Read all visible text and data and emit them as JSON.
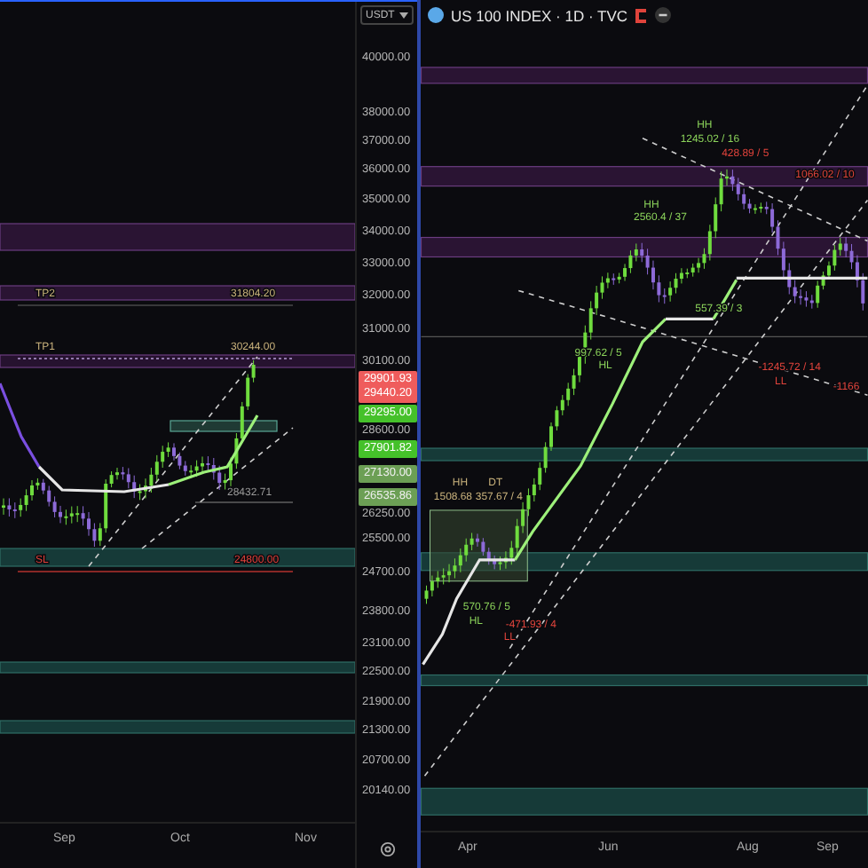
{
  "left_chart": {
    "currency_select": "USDT",
    "price_axis": [
      "40000.00",
      "38000.00",
      "37000.00",
      "36000.00",
      "35000.00",
      "34000.00",
      "33000.00",
      "32000.00",
      "31000.00",
      "30100.00",
      "28600.00",
      "26250.00",
      "25500.00",
      "24700.00",
      "23800.00",
      "23100.00",
      "22500.00",
      "21900.00",
      "21300.00",
      "20700.00",
      "20140.00"
    ],
    "price_tags": [
      {
        "lines": [
          "29901.93",
          "29440.20"
        ],
        "kind": "last"
      },
      {
        "lines": [
          "29295.00"
        ],
        "kind": "position"
      },
      {
        "lines": [
          "27901.82"
        ],
        "kind": "position"
      },
      {
        "lines": [
          "27130.00"
        ],
        "kind": "level"
      },
      {
        "lines": [
          "26535.86"
        ],
        "kind": "level"
      }
    ],
    "annotations": [
      {
        "text": "TP2",
        "kind": "target"
      },
      {
        "text": "31804.20",
        "kind": "target"
      },
      {
        "text": "TP1",
        "kind": "target"
      },
      {
        "text": "30244.00",
        "kind": "target"
      },
      {
        "text": "28432.71",
        "kind": "info"
      },
      {
        "text": "SL",
        "kind": "loss"
      },
      {
        "text": "24800.00",
        "kind": "loss"
      }
    ],
    "time_axis": [
      "Sep",
      "Oct",
      "Nov"
    ]
  },
  "right_chart": {
    "symbol": "US 100 INDEX · 1D · TVC",
    "annotations": [
      {
        "text": "HH",
        "kind": "gain"
      },
      {
        "text": "1245.02 / 16",
        "kind": "gain"
      },
      {
        "text": "428.89 / 5",
        "kind": "loss"
      },
      {
        "text": "1066.02 / 10",
        "kind": "loss"
      },
      {
        "text": "HH",
        "kind": "gain"
      },
      {
        "text": "2560.4 / 37",
        "kind": "gain"
      },
      {
        "text": "557.39 / 3",
        "kind": "gain"
      },
      {
        "text": "997.62 / 5",
        "kind": "gain"
      },
      {
        "text": "HL",
        "kind": "gain"
      },
      {
        "text": "-1245.72 / 14",
        "kind": "loss"
      },
      {
        "text": "LL",
        "kind": "loss"
      },
      {
        "text": "-1166",
        "kind": "loss"
      },
      {
        "text": "HH",
        "kind": "target"
      },
      {
        "text": "DT",
        "kind": "target"
      },
      {
        "text": "1508.68",
        "kind": "target"
      },
      {
        "text": "357.67 / 4",
        "kind": "target"
      },
      {
        "text": "570.76 / 5",
        "kind": "gain"
      },
      {
        "text": "HL",
        "kind": "gain"
      },
      {
        "text": "-471.93 / 4",
        "kind": "loss"
      },
      {
        "text": "LL",
        "kind": "loss"
      }
    ],
    "time_axis": [
      "Apr",
      "Jun",
      "Aug",
      "Sep"
    ]
  }
}
